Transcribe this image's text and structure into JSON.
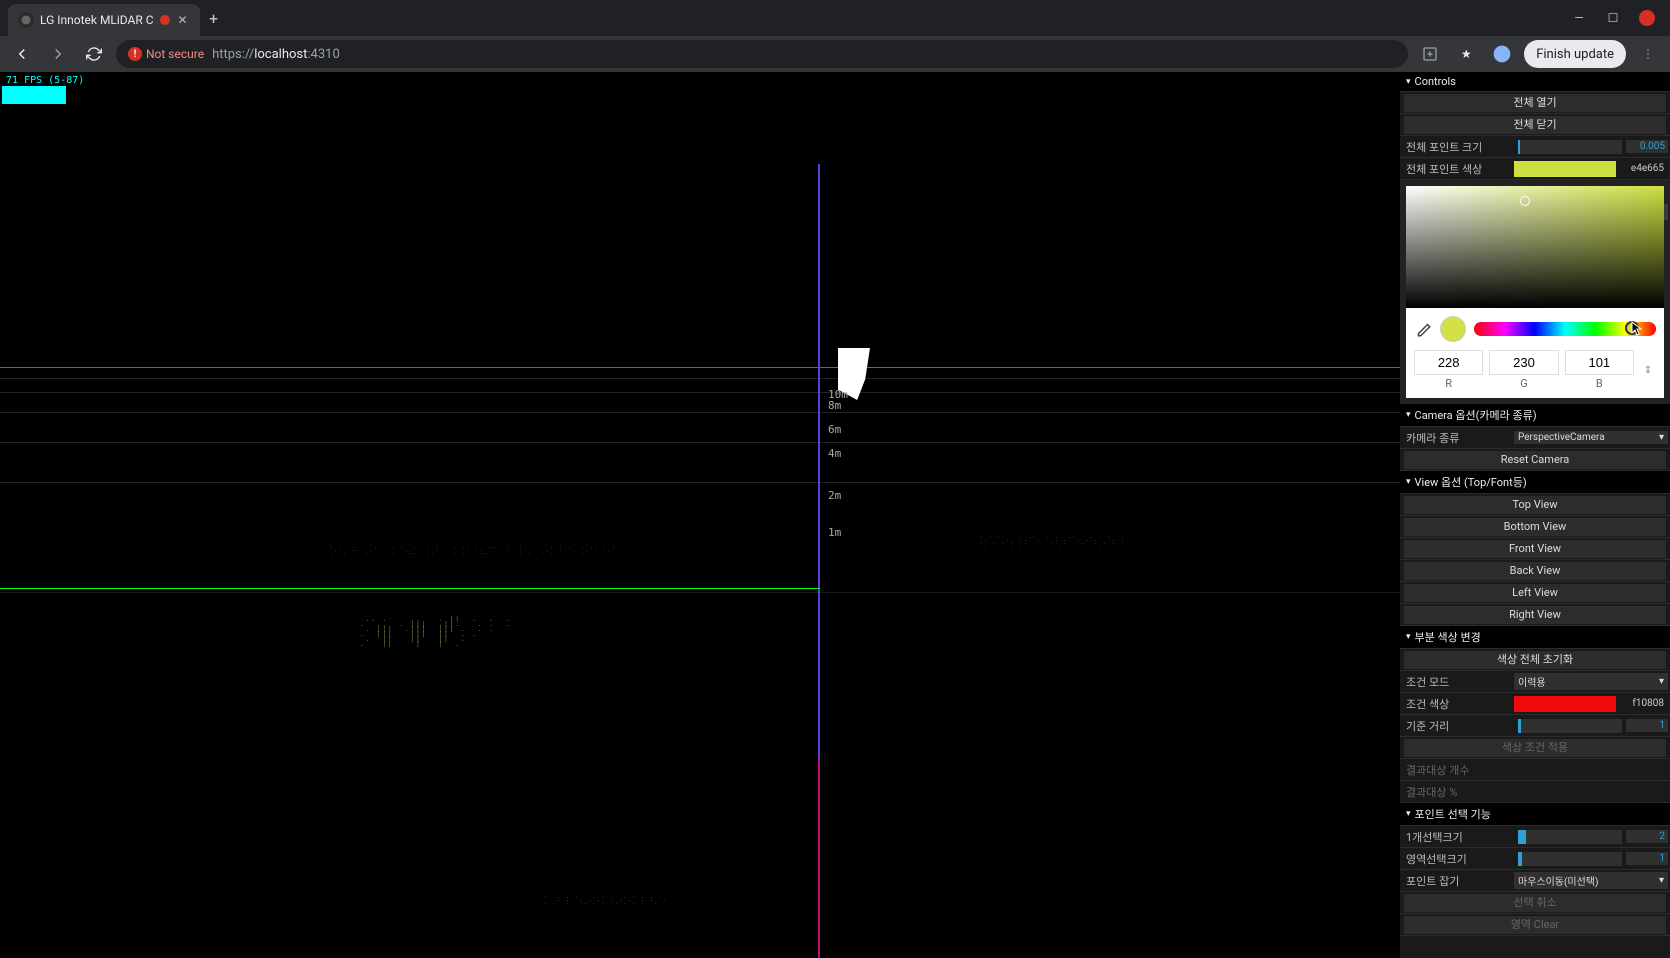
{
  "browser": {
    "tab_title": "LG Innotek MLiDAR C",
    "warn_text": "Not secure",
    "url_scheme": "https://",
    "url_host": "localhost",
    "url_port": ":4310",
    "finish_update": "Finish update"
  },
  "fps": "71 FPS (5-87)",
  "ruler": [
    "10m",
    "8m",
    "6m",
    "4m",
    "2m",
    "1m"
  ],
  "ruler_tops": [
    316,
    327,
    351,
    375,
    417,
    454
  ],
  "panel": {
    "controls_title": "Controls",
    "open_all": "전체 열기",
    "close_all": "전체 닫기",
    "point_size_label": "전체 포인트 크기",
    "point_size_value": "0.005",
    "point_color_label": "전체 포인트 색상",
    "point_color_hex": "e4e665",
    "side_num_a": "2",
    "picker": {
      "r": "228",
      "g": "230",
      "b": "101",
      "r_lab": "R",
      "g_lab": "G",
      "b_lab": "B"
    },
    "camera_folder": "Camera 옵션(카메라 종류)",
    "camera_type_label": "카메라 종류",
    "camera_type_value": "PerspectiveCamera",
    "reset_camera": "Reset Camera",
    "view_folder": "View 옵션 (Top/Font등)",
    "views": [
      "Top View",
      "Bottom View",
      "Front View",
      "Back View",
      "Left View",
      "Right View"
    ],
    "partial_folder": "부분 색상 변경",
    "color_reset": "색상 전체 초기화",
    "cond_mode_label": "조건 모드",
    "cond_mode_value": "이력용",
    "cond_color_label": "조건 색상",
    "cond_color_hex": "f10808",
    "base_dist_label": "기준 거리",
    "base_dist_value": "1",
    "apply_cond": "색상 조건 적용",
    "result_count_label": "결과대상 개수",
    "result_pct_label": "결과대상 %",
    "point_select_folder": "포인트 선택 기능",
    "single_sel_label": "1개선택크기",
    "single_sel_value": "2",
    "area_sel_label": "영역선택크기",
    "area_sel_value": "1",
    "point_snap_label": "포인트 잡기",
    "point_snap_value": "마우스이동(미선택)",
    "cancel_sel": "선택 취소",
    "region_clear": "영역 Clear"
  }
}
